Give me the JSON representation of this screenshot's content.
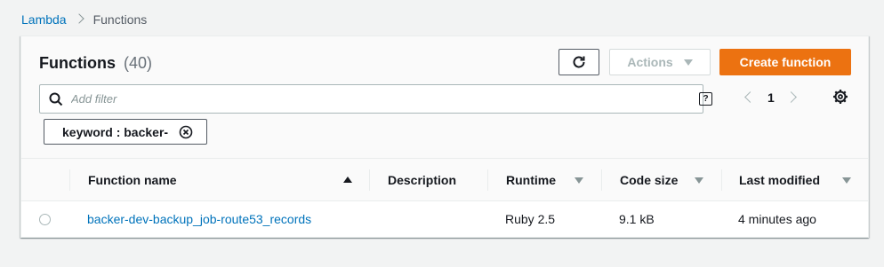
{
  "breadcrumb": {
    "root": "Lambda",
    "current": "Functions"
  },
  "header": {
    "title": "Functions",
    "count": "(40)",
    "actions_label": "Actions",
    "create_label": "Create function"
  },
  "filter": {
    "placeholder": "Add filter",
    "help": "?"
  },
  "pagination": {
    "page": "1"
  },
  "token": {
    "label": "keyword : backer-"
  },
  "table": {
    "columns": {
      "name": "Function name",
      "description": "Description",
      "runtime": "Runtime",
      "code_size": "Code size",
      "last_modified": "Last modified"
    },
    "rows": [
      {
        "name": "backer-dev-backup_job-route53_records",
        "description": "",
        "runtime": "Ruby 2.5",
        "code_size": "9.1 kB",
        "last_modified": "4 minutes ago"
      }
    ]
  },
  "colors": {
    "accent": "#ec7211",
    "link": "#0073bb"
  }
}
